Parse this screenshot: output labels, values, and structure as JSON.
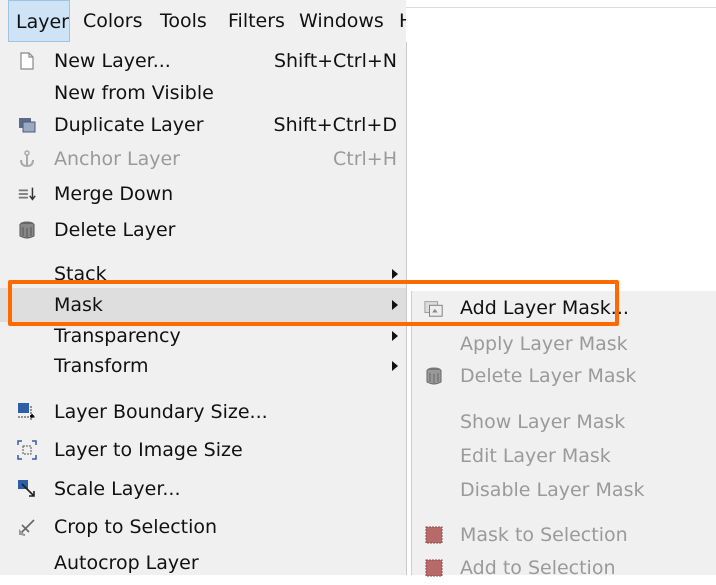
{
  "menubar": {
    "items": [
      "Layer",
      "Colors",
      "Tools",
      "Filters",
      "Windows",
      "H"
    ]
  },
  "layer_menu": {
    "items": [
      {
        "label": "New Layer...",
        "shortcut": "Shift+Ctrl+N",
        "icon": "new-layer-icon"
      },
      {
        "label": "New from Visible",
        "shortcut": "",
        "icon": ""
      },
      {
        "label": "Duplicate Layer",
        "shortcut": "Shift+Ctrl+D",
        "icon": "duplicate-layer-icon"
      },
      {
        "label": "Anchor Layer",
        "shortcut": "Ctrl+H",
        "icon": "anchor-icon",
        "disabled": true
      },
      {
        "label": "Merge Down",
        "shortcut": "",
        "icon": "merge-down-icon"
      },
      {
        "label": "Delete Layer",
        "shortcut": "",
        "icon": "delete-icon"
      },
      {
        "label": "Stack",
        "submenu": true
      },
      {
        "label": "Mask",
        "submenu": true,
        "highlighted": true
      },
      {
        "label": "Transparency",
        "submenu": true
      },
      {
        "label": "Transform",
        "submenu": true
      },
      {
        "label": "Layer Boundary Size...",
        "icon": "layer-boundary-icon"
      },
      {
        "label": "Layer to Image Size",
        "icon": "layer-to-image-icon"
      },
      {
        "label": "Scale Layer...",
        "icon": "scale-layer-icon"
      },
      {
        "label": "Crop to Selection",
        "icon": "crop-icon"
      },
      {
        "label": "Autocrop Layer",
        "icon": ""
      }
    ]
  },
  "mask_submenu": {
    "items": [
      {
        "label": "Add Layer Mask...",
        "icon": "add-mask-icon",
        "disabled": false
      },
      {
        "label": "Apply Layer Mask",
        "icon": "",
        "disabled": true
      },
      {
        "label": "Delete Layer Mask",
        "icon": "delete-icon",
        "disabled": true
      },
      {
        "label": "Show Layer Mask",
        "icon": "",
        "disabled": true
      },
      {
        "label": "Edit Layer Mask",
        "icon": "",
        "disabled": true
      },
      {
        "label": "Disable Layer Mask",
        "icon": "",
        "disabled": true
      },
      {
        "label": "Mask to Selection",
        "icon": "mask-selection-icon",
        "disabled": true
      },
      {
        "label": "Add to Selection",
        "icon": "mask-selection-icon",
        "disabled": true
      }
    ]
  },
  "colors": {
    "highlight_border": "#ff6a00",
    "menu_bg": "#f0f0f0",
    "disabled_text": "#9a9a9a"
  }
}
